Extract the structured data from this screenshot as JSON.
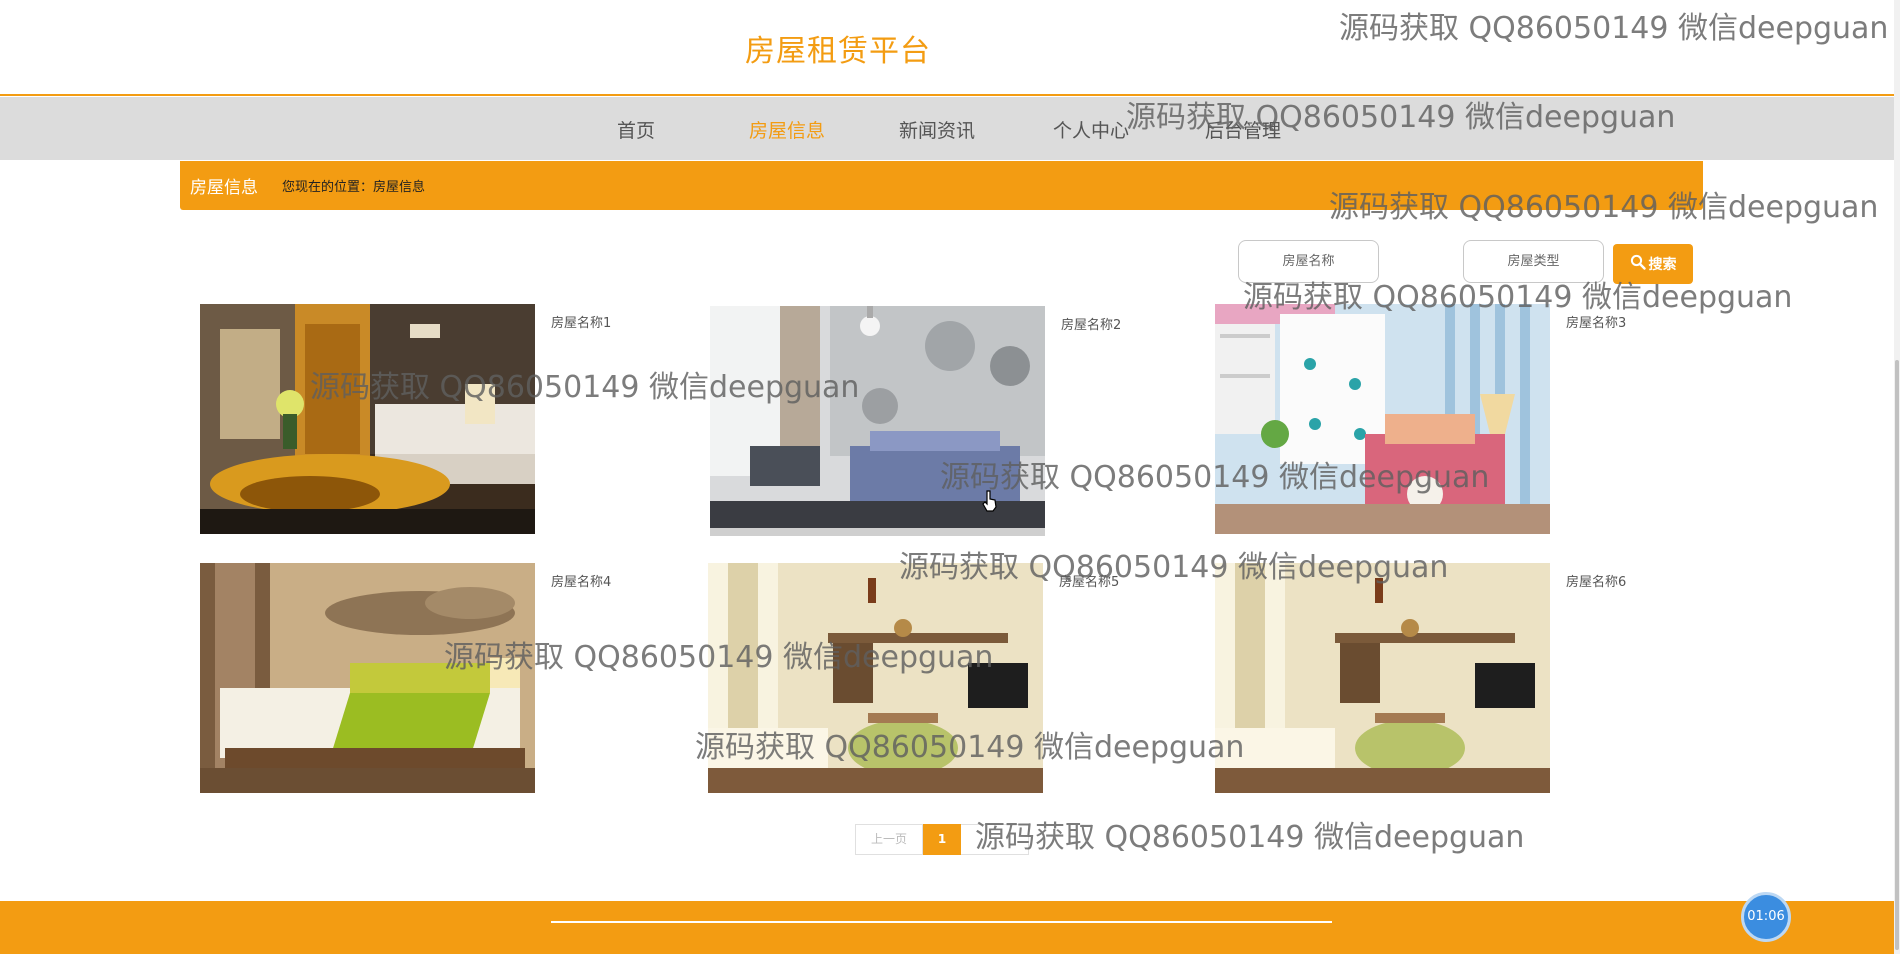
{
  "header": {
    "title": "房屋租赁平台"
  },
  "nav": {
    "items": [
      "首页",
      "房屋信息",
      "新闻资讯",
      "个人中心",
      "后台管理"
    ],
    "active_index": 1
  },
  "breadcrumb": {
    "title": "房屋信息",
    "location": "您现在的位置：房屋信息"
  },
  "search": {
    "name_placeholder": "房屋名称",
    "type_placeholder": "房屋类型",
    "button_label": "搜索"
  },
  "listings": [
    {
      "name": "房屋名称1"
    },
    {
      "name": "房屋名称2"
    },
    {
      "name": "房屋名称3"
    },
    {
      "name": "房屋名称4"
    },
    {
      "name": "房屋名称5"
    },
    {
      "name": "房屋名称6"
    }
  ],
  "pagination": {
    "prev_label": "上一页",
    "current_page": "1"
  },
  "timer": "01:06",
  "watermark": "源码获取 QQ86050149 微信deepguan",
  "colors": {
    "accent": "#f39c12",
    "nav_bg": "#dcdcdc",
    "timer": "#3b8de0"
  }
}
